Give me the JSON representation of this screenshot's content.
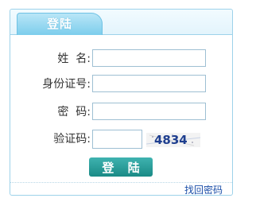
{
  "tab": {
    "label": "登陆"
  },
  "form": {
    "username": {
      "label": "姓  名:",
      "value": "",
      "placeholder": ""
    },
    "id_number": {
      "label": "身份证号:",
      "value": "",
      "placeholder": ""
    },
    "password": {
      "label": "密  码:",
      "value": "",
      "placeholder": ""
    },
    "captcha": {
      "label": "验证码:",
      "value": "",
      "placeholder": "",
      "image_text": "4834"
    },
    "submit_label": "登 陆"
  },
  "footer": {
    "forgot_password_label": "找回密码"
  },
  "colors": {
    "border": "#9dd2ea",
    "tab": "#7ccdec",
    "button": "#1a8a86",
    "link": "#1a4ea8",
    "captcha_text": "#1f3f8f"
  }
}
